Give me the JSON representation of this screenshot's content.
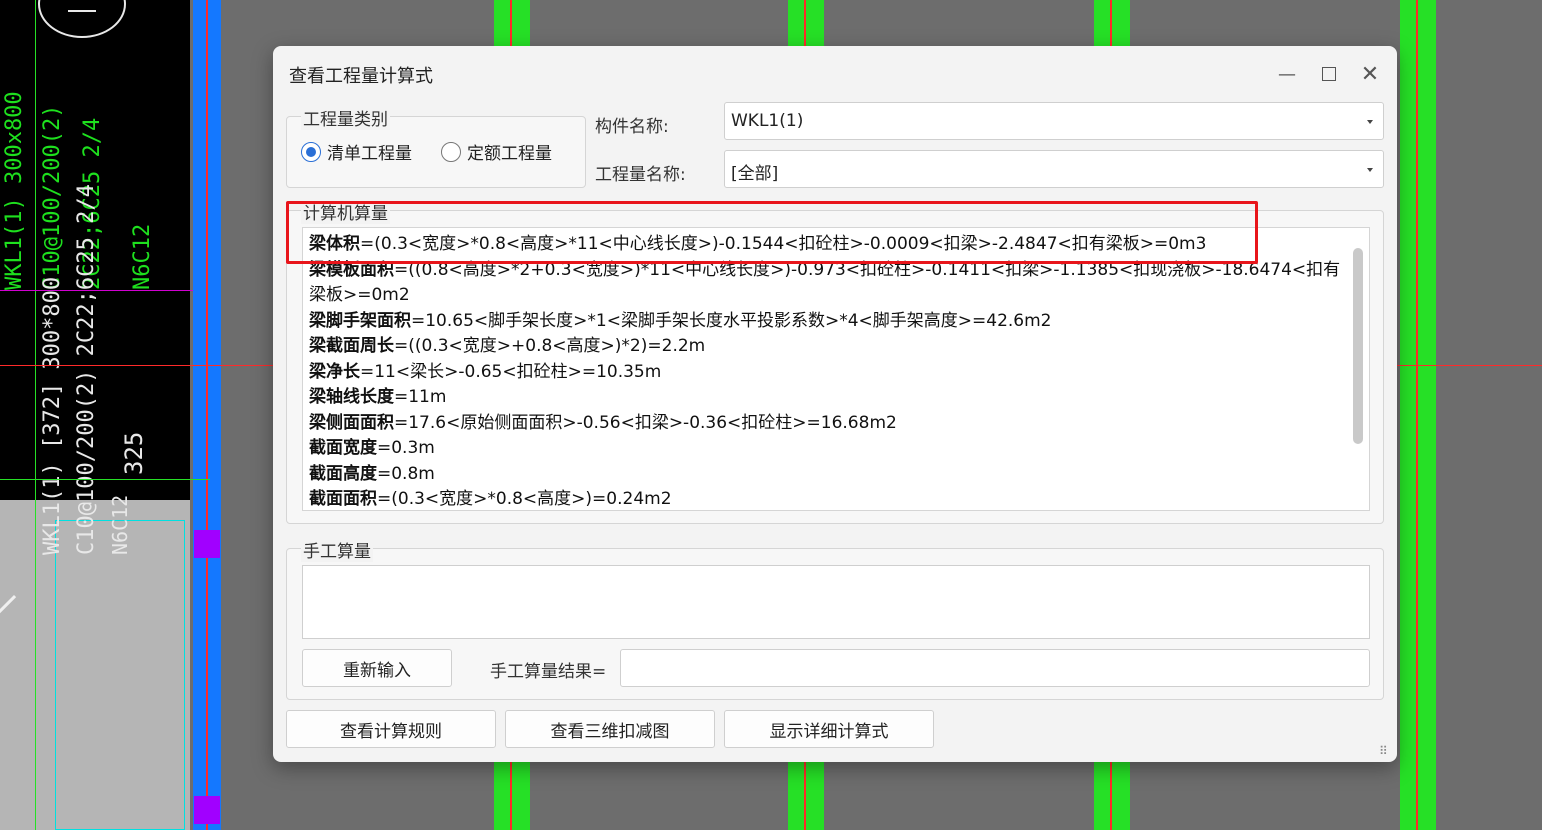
{
  "cad": {
    "texts": [
      "WKL1(1) 300x800",
      "C10@100/200(2)",
      "2C22;6C25 2/4",
      "N6C12",
      "WKL1(1) [372] 300*800",
      "C10@100/200(2) 2C22;6C25 2/4",
      "N6C12",
      "325"
    ]
  },
  "dialog": {
    "title": "查看工程量计算式",
    "type_group": {
      "label": "工程量类别",
      "option1": "清单工程量",
      "option2": "定额工程量",
      "selected": "清单工程量"
    },
    "component_label": "构件名称:",
    "component_value": "WKL1(1)",
    "quantity_label": "工程量名称:",
    "quantity_value": "[全部]",
    "calc_group_label": "计算机算量",
    "calc_lines": [
      {
        "name": "梁体积",
        "expr": "=(0.3<宽度>*0.8<高度>*11<中心线长度>)-0.1544<扣砼柱>-0.0009<扣梁>-2.4847<扣有梁板>=0m3"
      },
      {
        "name": "梁模板面积",
        "expr": "=((0.8<高度>*2+0.3<宽度>)*11<中心线长度>)-0.973<扣砼柱>-0.1411<扣梁>-1.1385<扣现浇板>-18.6474<扣有"
      },
      {
        "name": "",
        "expr": "梁板>=0m2"
      },
      {
        "name": "梁脚手架面积",
        "expr": "=10.65<脚手架长度>*1<梁脚手架长度水平投影系数>*4<脚手架高度>=42.6m2"
      },
      {
        "name": "梁截面周长",
        "expr": "=((0.3<宽度>+0.8<高度>)*2)=2.2m"
      },
      {
        "name": "梁净长",
        "expr": "=11<梁长>-0.65<扣砼柱>=10.35m"
      },
      {
        "name": "梁轴线长度",
        "expr": "=11m"
      },
      {
        "name": "梁侧面面积",
        "expr": "=17.6<原始侧面面积>-0.56<扣梁>-0.36<扣砼柱>=16.68m2"
      },
      {
        "name": "截面宽度",
        "expr": "=0.3m"
      },
      {
        "name": "截面高度",
        "expr": "=0.8m"
      },
      {
        "name": "截面面积",
        "expr": "=(0.3<宽度>*0.8<高度>)=0.24m2"
      }
    ],
    "manual_group_label": "手工算量",
    "reenter_label": "重新输入",
    "manual_result_label": "手工算量结果=",
    "rules_label": "查看计算规则",
    "view3d_label": "查看三维扣减图",
    "detail_label": "显示详细计算式"
  }
}
